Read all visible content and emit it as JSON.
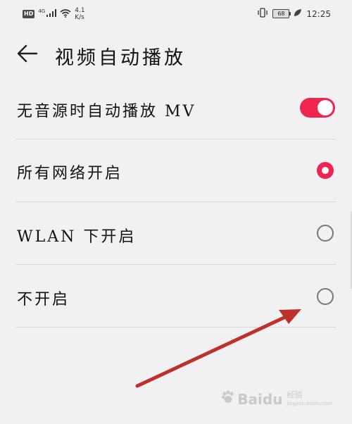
{
  "status_bar": {
    "hd": "HD",
    "network_type": "4G",
    "speed_value": "4.1",
    "speed_unit": "K/s",
    "battery": "68",
    "time": "12:25"
  },
  "header": {
    "title": "视频自动播放"
  },
  "settings": {
    "toggle_label": "无音源时自动播放 MV",
    "toggle_on": true,
    "options": [
      {
        "label": "所有网络开启",
        "checked": true
      },
      {
        "label": "WLAN 下开启",
        "checked": false
      },
      {
        "label": "不开启",
        "checked": false
      }
    ]
  },
  "watermark": {
    "text": "Baidu",
    "sub1": "经验",
    "sub2": "jingyan.baidu.com"
  },
  "colors": {
    "accent": "#f0254f",
    "annotation_arrow": "#c0302b",
    "background": "#f1f1f3"
  }
}
